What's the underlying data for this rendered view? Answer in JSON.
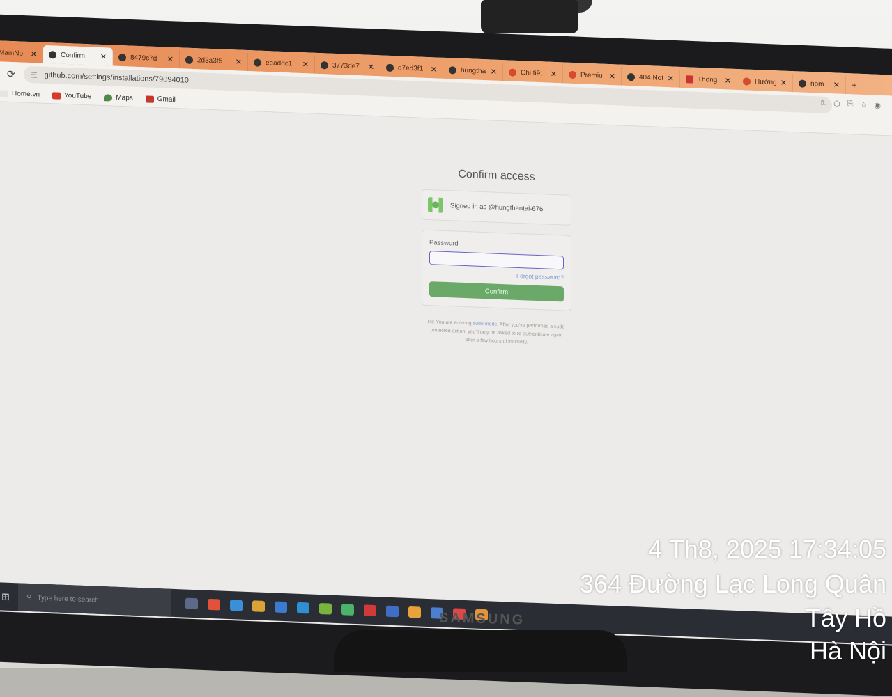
{
  "browser": {
    "tabs": [
      {
        "label": "MamNo",
        "active": false
      },
      {
        "label": "Confirm",
        "active": true
      },
      {
        "label": "8479c7d",
        "active": false
      },
      {
        "label": "2d3a3f5",
        "active": false
      },
      {
        "label": "eeaddc1",
        "active": false
      },
      {
        "label": "3773de7",
        "active": false
      },
      {
        "label": "d7ed3f1",
        "active": false
      },
      {
        "label": "hungthan",
        "active": false
      },
      {
        "label": "Chi tiết",
        "active": false
      },
      {
        "label": "Premiu",
        "active": false
      },
      {
        "label": "404 Not",
        "active": false
      },
      {
        "label": "Thông",
        "active": false
      },
      {
        "label": "Hướng",
        "active": false
      },
      {
        "label": "npm",
        "active": false
      }
    ],
    "new_tab": "+",
    "url": "github.com/settings/installations/79094010",
    "bookmarks": [
      {
        "label": "Home.vn",
        "color": "#e7e5e1"
      },
      {
        "label": "YouTube",
        "color": "#d9372b"
      },
      {
        "label": "Maps",
        "color": "#4f8a4b"
      },
      {
        "label": "Gmail",
        "color": "#c4382b"
      }
    ]
  },
  "page": {
    "title": "Confirm access",
    "signed_in_text": "Signed in as @hungthantai-676",
    "password_label": "Password",
    "forgot_link": "Forgot password?",
    "confirm_button": "Confirm",
    "tip_prefix": "Tip: You are entering",
    "tip_link": "sudo mode",
    "tip_suffix": ". After you've performed a sudo-protected action, you'll only be asked to re-authenticate again after a few hours of inactivity."
  },
  "taskbar": {
    "search_placeholder": "Type here to search",
    "app_colors": [
      "#5b6a8a",
      "#e0533a",
      "#3b8fd6",
      "#d9a338",
      "#3c7bd0",
      "#2f8fd4",
      "#7ab43e",
      "#4bb36a",
      "#d03a3a",
      "#3f6fc4",
      "#e9a13b",
      "#4d7fd0",
      "#e04848",
      "#e0943b"
    ]
  },
  "monitor": {
    "brand": "SAMSUNG"
  },
  "overlay": {
    "datetime": "4 Th8, 2025 17:34:05",
    "address_line1": "364 Đường Lạc Long Quân",
    "address_line2": "Tây Hồ",
    "address_line3": "Hà Nội"
  }
}
